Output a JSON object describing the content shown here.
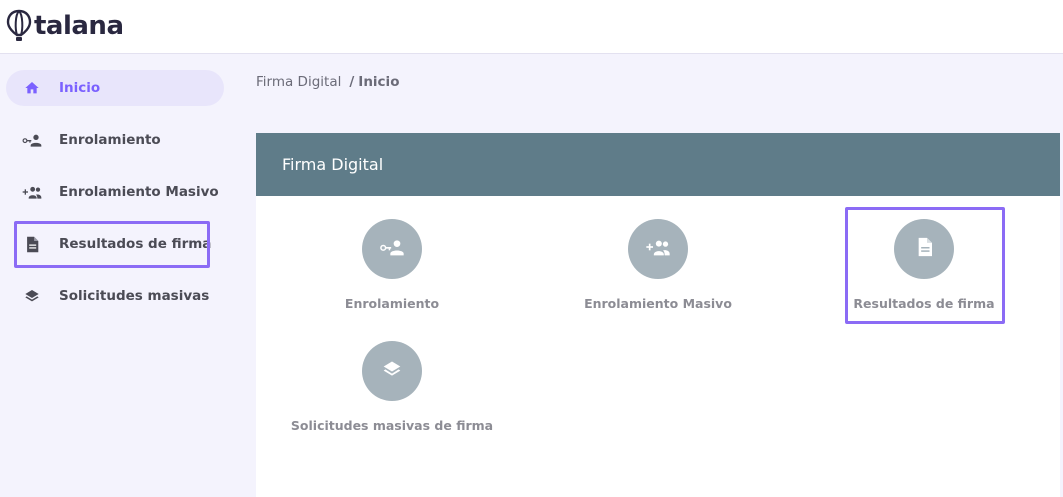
{
  "brand": {
    "name": "talana"
  },
  "sidebar": {
    "items": [
      {
        "label": "Inicio",
        "icon": "home-icon",
        "active": true
      },
      {
        "label": "Enrolamiento",
        "icon": "key-person-icon",
        "active": false
      },
      {
        "label": "Enrolamiento Masivo",
        "icon": "add-group-icon",
        "active": false
      },
      {
        "label": "Resultados de firma",
        "icon": "document-icon",
        "active": false
      },
      {
        "label": "Solicitudes masivas",
        "icon": "layers-icon",
        "active": false
      }
    ]
  },
  "breadcrumb": {
    "parent": "Firma Digital",
    "separator": "/",
    "current": "Inicio"
  },
  "card": {
    "title": "Firma Digital",
    "tiles": [
      {
        "label": "Enrolamiento",
        "icon": "key-person-icon"
      },
      {
        "label": "Enrolamiento Masivo",
        "icon": "add-group-icon"
      },
      {
        "label": "Resultados de firma",
        "icon": "document-icon"
      },
      {
        "label": "Solicitudes masivas de firma",
        "icon": "layers-icon"
      }
    ]
  },
  "colors": {
    "accent": "#7b61ff",
    "highlight": "#8b6bf5",
    "header": "#5f7c89",
    "tile_circle": "#a6b3bb",
    "background": "#f4f3fd"
  }
}
